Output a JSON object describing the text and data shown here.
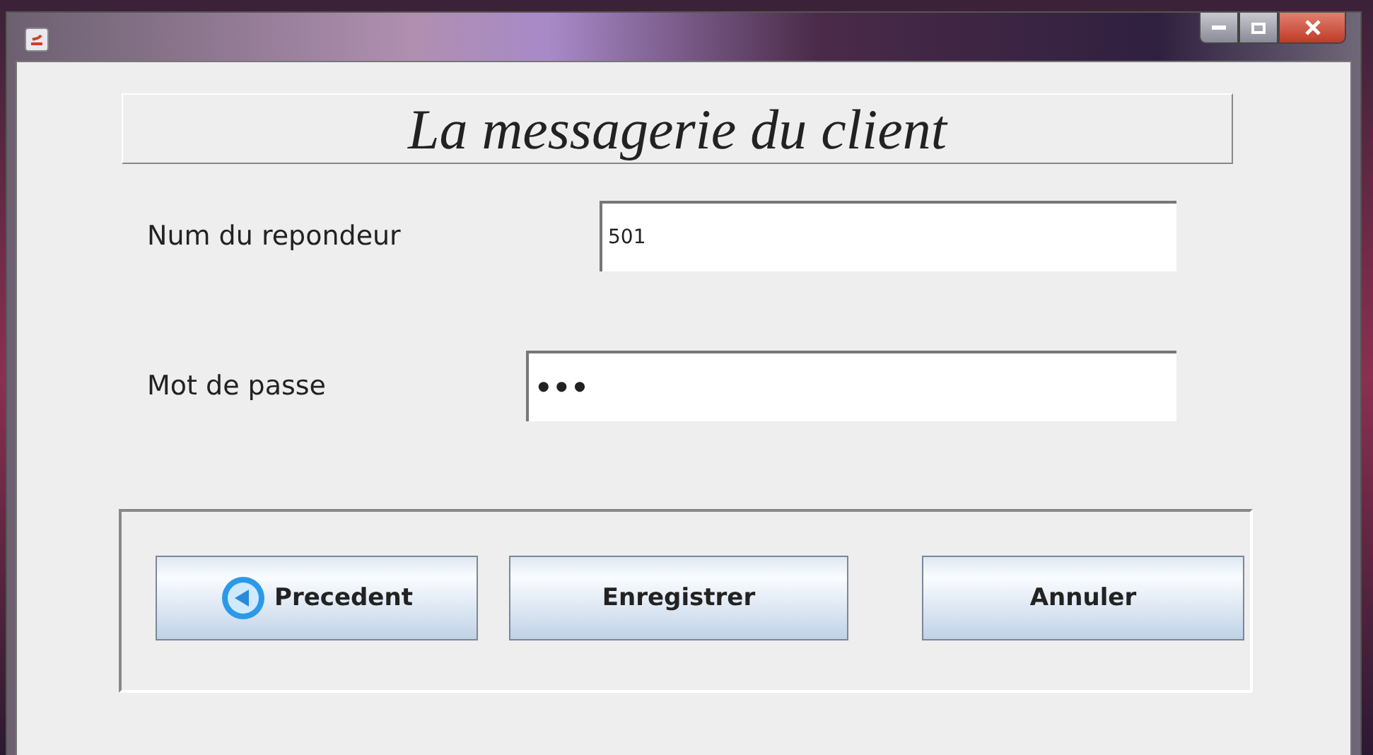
{
  "heading": "La messagerie du client",
  "fields": [
    {
      "label": "Num du repondeur",
      "value": "501",
      "kind": "text"
    },
    {
      "label": "Mot de passe",
      "value": "•••",
      "kind": "password"
    }
  ],
  "buttons": [
    {
      "label": "Precedent",
      "kind": "back"
    },
    {
      "label": "Enregistrer",
      "kind": "plain"
    },
    {
      "label": "Annuler",
      "kind": "plain"
    }
  ]
}
